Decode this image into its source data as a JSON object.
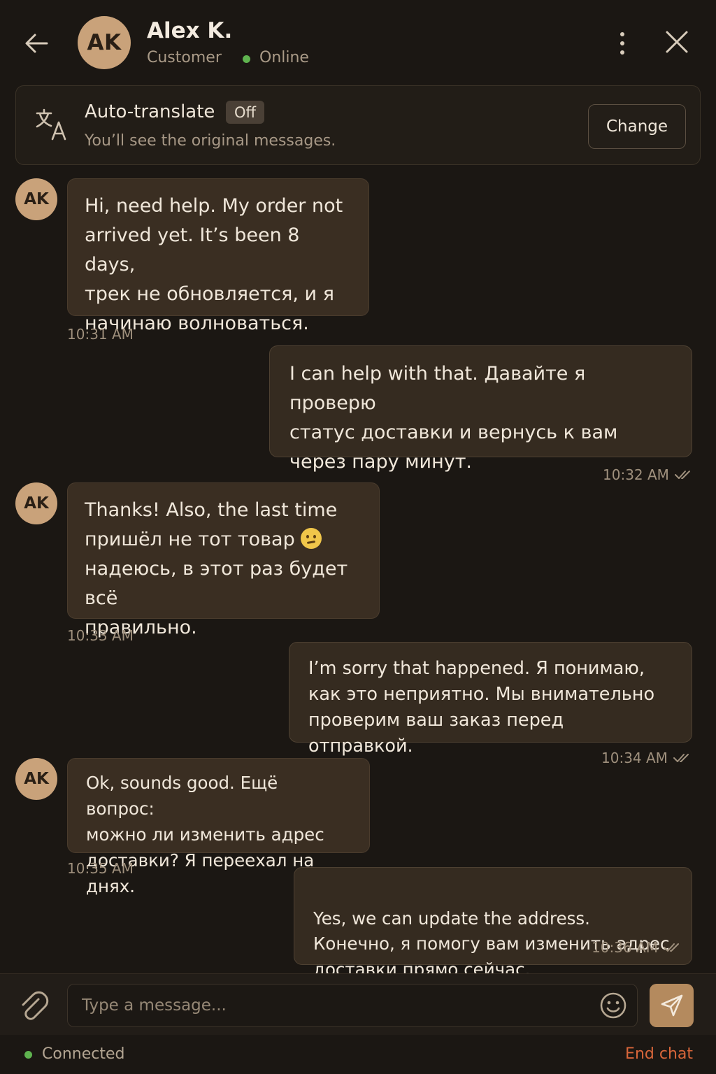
{
  "header": {
    "avatar_initials": "AK",
    "name": "Alex K.",
    "role": "Customer",
    "status": "Online"
  },
  "translate": {
    "title": "Auto-translate",
    "badge": "Off",
    "subtitle": "You’ll see the original messages.",
    "change_label": "Change"
  },
  "messages": [
    {
      "dir": "in",
      "text": "Hi, need help. My order not\narrived yet. It’s been 8 days,\nтрек не обновляется, и я\nначинаю волноваться.",
      "time": "10:31 AM"
    },
    {
      "dir": "out",
      "text": "I can help with that. Давайте я проверю\nстатус доставки и вернусь к вам\nчерез пару минут.",
      "time": "10:32 AM",
      "read": true
    },
    {
      "dir": "in",
      "text_before_emoji": "Thanks! Also, the last time\nпришёл не тот товар ",
      "emoji": "confused-face",
      "text_after_emoji": "\nнадеюсь, в этот раз будет всё\nправильно.",
      "time": "10:33 AM"
    },
    {
      "dir": "out",
      "text": "I’m sorry that happened. Я понимаю,\nкак это неприятно. Мы внимательно\nпроверим ваш заказ перед отправкой.",
      "time": "10:34 AM",
      "read": true
    },
    {
      "dir": "in",
      "text": "Ok, sounds good. Ещё вопрос:\nможно ли изменить адрес\nдоставки? Я переехал на днях.",
      "time": "10:35 AM"
    },
    {
      "dir": "out",
      "text": "Yes, we can update the address.\nКонечно, я помогу вам изменить адрес\nдоставки прямо сейчас.",
      "time": "10:36 AM",
      "read": true
    }
  ],
  "composer": {
    "placeholder": "Type a message..."
  },
  "footer": {
    "connection": "Connected",
    "end_chat": "End chat"
  },
  "colors": {
    "accent": "#b48a5e",
    "online": "#5fb34f",
    "danger": "#d9663a"
  }
}
